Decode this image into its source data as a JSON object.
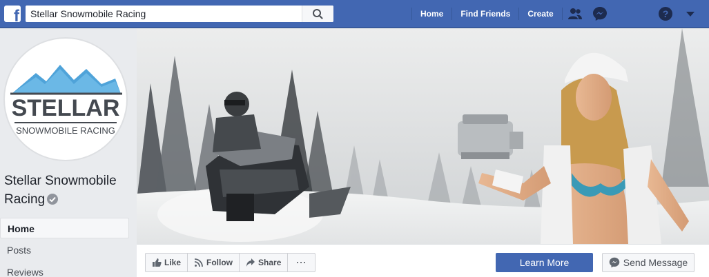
{
  "topbar": {
    "search_value": "Stellar Snowmobile Racing",
    "nav": [
      {
        "label": "Home"
      },
      {
        "label": "Find Friends"
      },
      {
        "label": "Create"
      }
    ]
  },
  "page": {
    "name": "Stellar Snowmobile Racing",
    "logo": {
      "title": "STELLAR",
      "subtitle": "SNOWMOBILE RACING"
    }
  },
  "left_nav": [
    {
      "label": "Home",
      "active": true
    },
    {
      "label": "Posts",
      "active": false
    },
    {
      "label": "Reviews",
      "active": false
    }
  ],
  "actions": {
    "like": "Like",
    "follow": "Follow",
    "share": "Share",
    "more": "···",
    "learn_more": "Learn More",
    "send_message": "Send Message"
  },
  "colors": {
    "brand_blue": "#4267b2",
    "logo_blue": "#4fa3d9",
    "logo_text": "#444950"
  },
  "icons": [
    "facebook-logo-icon",
    "search-icon",
    "friends-icon",
    "messenger-icon",
    "help-icon",
    "dropdown-caret-icon",
    "verified-badge-icon",
    "like-icon",
    "follow-icon",
    "share-icon",
    "messenger-icon"
  ]
}
